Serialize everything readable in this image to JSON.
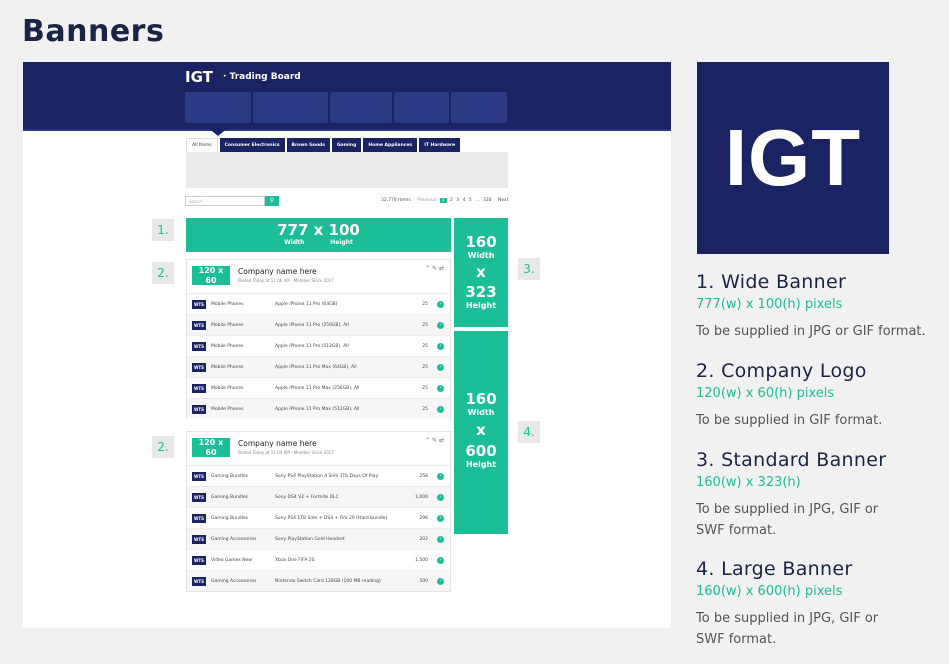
{
  "page_title": "Banners",
  "mockup": {
    "brand": "IGT",
    "brand_sub": "· Trading Board",
    "tabs": [
      "All Items",
      "Consumer Electronics",
      "Brown Goods",
      "Gaming",
      "Home Appliances",
      "IT Hardware"
    ],
    "search_placeholder": "Search",
    "search_icon": "search-icon",
    "pager": {
      "count": "32,778 Items",
      "previous": "Previous",
      "pages": [
        "1",
        "2",
        "3",
        "4",
        "5",
        "...",
        "328"
      ],
      "current": "1",
      "next": "Next"
    },
    "wide_banner": {
      "size": "777 x 100",
      "width_label": "Width",
      "height_label": "Height"
    },
    "standard_banner": {
      "w": "160",
      "width_label": "Width",
      "x": "x",
      "h": "323",
      "height_label": "Height"
    },
    "large_banner": {
      "w": "160",
      "width_label": "Width",
      "x": "x",
      "h": "600",
      "height_label": "Height"
    },
    "tags": [
      "1.",
      "2.",
      "2.",
      "3.",
      "4."
    ],
    "cards": [
      {
        "logo_size": "120 x 60",
        "logo_width_label": "Width",
        "logo_height_label": "Height",
        "company_name": "Company name here",
        "posted": "Posted Today at 11:06 AM - Member Since 2017",
        "rows": [
          {
            "badge": "WTS",
            "category": "Mobile Phones",
            "item": "Apple iPhone 11 Pro (64GB)",
            "qty": "25"
          },
          {
            "badge": "WTS",
            "category": "Mobile Phones",
            "item": "Apple iPhone 11 Pro (256GB), All",
            "qty": "25"
          },
          {
            "badge": "WTS",
            "category": "Mobile Phones",
            "item": "Apple iPhone 11 Pro (512GB), All",
            "qty": "25"
          },
          {
            "badge": "WTS",
            "category": "Mobile Phones",
            "item": "Apple iPhone 11 Pro Max (64GB), All",
            "qty": "25"
          },
          {
            "badge": "WTS",
            "category": "Mobile Phones",
            "item": "Apple iPhone 11 Pro Max (256GB), All",
            "qty": "25"
          },
          {
            "badge": "WTS",
            "category": "Mobile Phones",
            "item": "Apple iPhone 11 Pro Max (512GB), All",
            "qty": "25"
          }
        ]
      },
      {
        "logo_size": "120 x 60",
        "logo_width_label": "Width",
        "logo_height_label": "Height",
        "company_name": "Company name here",
        "posted": "Posted Today at 11:04 AM - Member Since 2017",
        "rows": [
          {
            "badge": "WTS",
            "category": "Gaming Bundles",
            "item": "Sony PS4 PlayStation 4 Slim 1Tb Days Of Play",
            "qty": "258"
          },
          {
            "badge": "WTS",
            "category": "Gaming Bundles",
            "item": "Sony DS4 V2 + Fortnite DLC",
            "qty": "1,000"
          },
          {
            "badge": "WTS",
            "category": "Gaming Bundles",
            "item": "Sony PS4 1TB Slim + DS4 + Fifa 20 (Hard bundle)",
            "qty": "296"
          },
          {
            "badge": "WTS",
            "category": "Gaming Accessories",
            "item": "Sony PlayStation Gold Headset",
            "qty": "202"
          },
          {
            "badge": "WTS",
            "category": "Video Games New",
            "item": "Xbox One FIFA 20",
            "qty": "1,500"
          },
          {
            "badge": "WTS",
            "category": "Gaming Accessories",
            "item": "Nintendo Switch Card 128GB (100 MB reading)",
            "qty": "500"
          }
        ]
      }
    ],
    "colors": {
      "navy": "#1b2462",
      "green": "#1bbe97"
    }
  },
  "logo_text": "IGT",
  "descriptions": [
    {
      "title": "1. Wide Banner",
      "dimensions": "777(w) x 100(h) pixels",
      "format": "To be supplied in JPG or GIF format."
    },
    {
      "title": "2. Company Logo",
      "dimensions": "120(w) x 60(h) pixels",
      "format": "To be supplied in GIF format."
    },
    {
      "title": "3. Standard Banner",
      "dimensions": "160(w) x 323(h)",
      "format": "To be supplied in JPG, GIF or SWF format."
    },
    {
      "title": "4. Large Banner",
      "dimensions": "160(w) x 600(h) pixels",
      "format": "To be supplied in JPG, GIF or SWF format."
    }
  ]
}
